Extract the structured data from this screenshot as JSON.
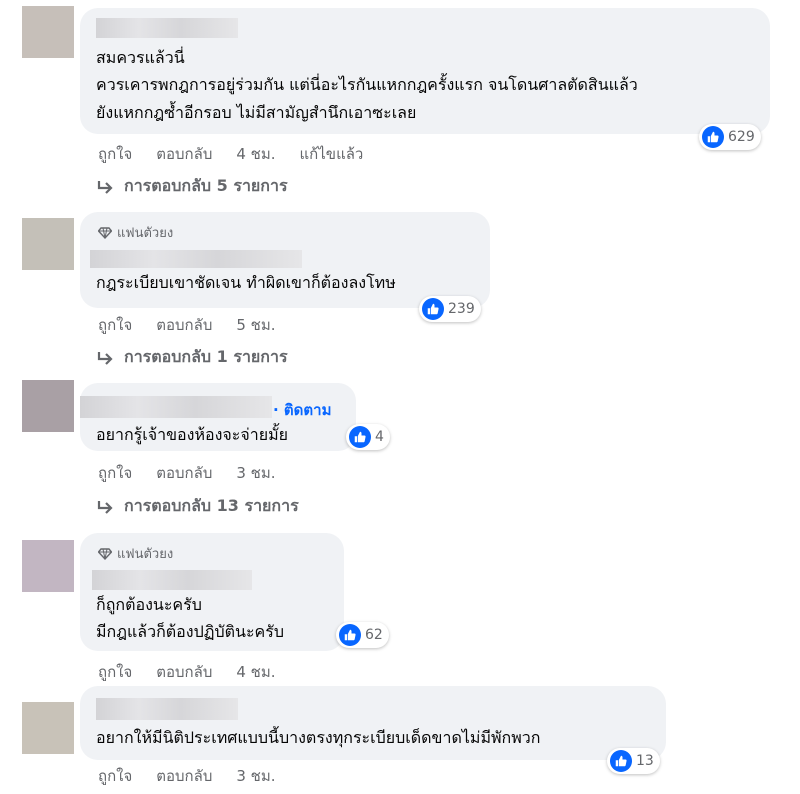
{
  "labels": {
    "like": "ถูกใจ",
    "reply": "ตอบกลับ",
    "fan_badge": "แฟนตัวยง",
    "follow": "· ติดตาม",
    "edited": "แก้ไขแล้ว"
  },
  "comments": [
    {
      "lines": [
        "สมควรแล้วนี่",
        "ควรเคารพกฎการอยู่ร่วมกัน แต่นี่อะไรกันแหกกฎครั้งแรก จนโดนศาลตัดสินแล้ว",
        "ยังแหกกฎซ้ำอีกรอบ ไม่มีสามัญสำนึกเอาซะเลย"
      ],
      "reactions": "629",
      "time": "4 ชม.",
      "replies": "การตอบกลับ 5 รายการ"
    },
    {
      "lines": [
        "กฎระเบียบเขาชัดเจน ทำผิดเขาก็ต้องลงโทษ"
      ],
      "reactions": "239",
      "time": "5 ชม.",
      "replies": "การตอบกลับ 1 รายการ"
    },
    {
      "lines": [
        "อยากรู้เจ้าของห้องจะจ่ายมั้ย"
      ],
      "reactions": "4",
      "time": "3 ชม.",
      "replies": "การตอบกลับ 13 รายการ"
    },
    {
      "lines": [
        "ก็ถูกต้องนะครับ",
        "มีกฎแล้วก็ต้องปฏิบัตินะครับ"
      ],
      "reactions": "62",
      "time": "4 ชม."
    },
    {
      "lines": [
        "อยากให้มีนิติประเทศแบบนี้บางตรงทุกระเบียบเด็ดขาดไม่มีพักพวก"
      ],
      "reactions": "13",
      "time": "3 ชม."
    }
  ],
  "colors": {
    "bubble": "#f0f2f5",
    "like_blue": "#0866ff",
    "meta_gray": "#65676b"
  },
  "icons": {
    "like": "thumbs-up-icon",
    "diamond": "diamond-icon",
    "reply_arrow": "reply-arrow-icon"
  }
}
